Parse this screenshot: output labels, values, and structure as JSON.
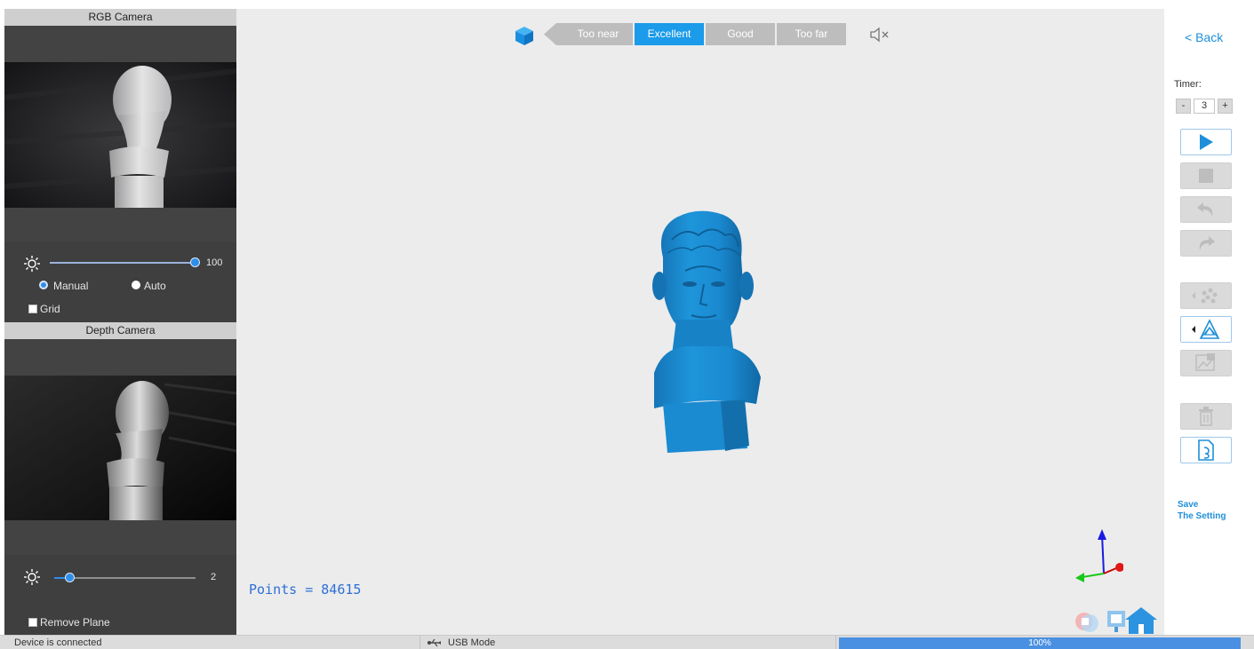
{
  "left_panel": {
    "rgb_title": "RGB Camera",
    "rgb_brightness_value": "100",
    "rgb_brightness_level": 1.0,
    "mode_manual_label": "Manual",
    "mode_auto_label": "Auto",
    "selected_mode": "Manual",
    "grid_label": "Grid",
    "depth_title": "Depth Camera",
    "depth_brightness_value": "2",
    "remove_plane_label": "Remove Plane"
  },
  "toolbar": {
    "quality_segments": [
      "Too near",
      "Excellent",
      "Good",
      "Too far"
    ],
    "active_segment": "Excellent",
    "cube_icon": "cube-icon",
    "mute_icon": "speaker-muted-icon"
  },
  "viewport": {
    "points_label": "Points = 84615",
    "model_color": "#1a8ad1"
  },
  "right_panel": {
    "back_label": "< Back",
    "timer_label": "Timer:",
    "timer_minus": "-",
    "timer_value": "3",
    "timer_plus": "+",
    "save_line1": "Save",
    "save_line2": "The Setting",
    "tools": [
      {
        "name": "play-icon",
        "enabled": true
      },
      {
        "name": "stop-icon",
        "enabled": false
      },
      {
        "name": "undo-icon",
        "enabled": false
      },
      {
        "name": "redo-icon",
        "enabled": false
      },
      {
        "name": "point-cloud-icon",
        "enabled": false
      },
      {
        "name": "mesh-icon",
        "enabled": true
      },
      {
        "name": "texture-icon",
        "enabled": false
      },
      {
        "name": "trash-icon",
        "enabled": false
      },
      {
        "name": "export-icon",
        "enabled": true
      }
    ]
  },
  "status_bar": {
    "device_status": "Device is connected",
    "mode": "USB Mode",
    "progress_label": "100%",
    "progress_value": 1.0
  },
  "colors": {
    "accent": "#1b9be9",
    "link": "#1e8fd8",
    "points_text": "#2e6fd6",
    "inactive_segment": "#bdbdbd"
  }
}
